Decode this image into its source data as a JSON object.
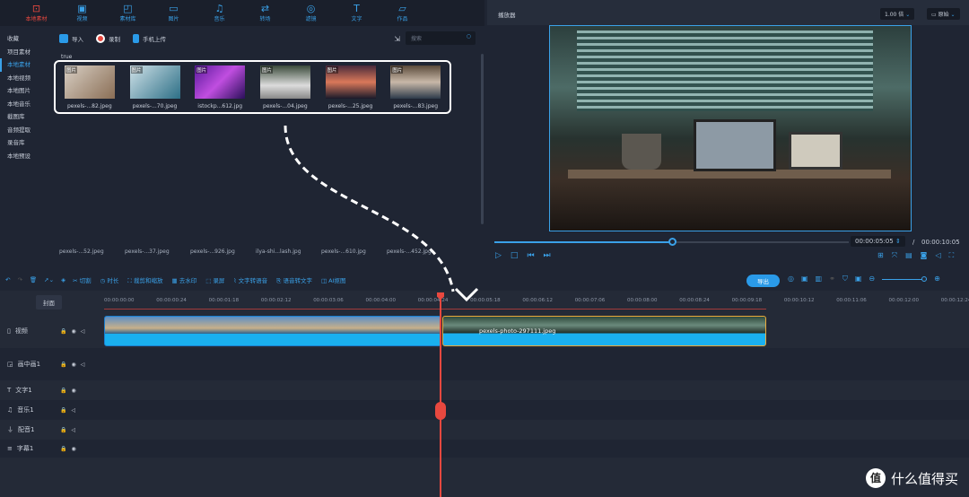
{
  "nav": {
    "tabs": [
      {
        "label": "本地素材",
        "icon": "download-box-icon",
        "active": true
      },
      {
        "label": "视频",
        "icon": "film-icon"
      },
      {
        "label": "素材库",
        "icon": "library-icon"
      },
      {
        "label": "图片",
        "icon": "image-icon"
      },
      {
        "label": "音乐",
        "icon": "music-icon"
      },
      {
        "label": "转场",
        "icon": "swap-icon"
      },
      {
        "label": "滤镜",
        "icon": "filter-icon"
      },
      {
        "label": "文字",
        "icon": "text-icon"
      },
      {
        "label": "作品",
        "icon": "folder-icon"
      }
    ]
  },
  "sidebar": {
    "items": [
      "收藏",
      "项目素材",
      "本地素材",
      "本地视频",
      "本地图片",
      "本地音乐",
      "截图库",
      "音频提取",
      "录音库",
      "本地预设"
    ],
    "active_index": 2
  },
  "toolbar": {
    "import": "导入",
    "record": "录制",
    "phone_upload": "手机上传",
    "search_placeholder": "搜索"
  },
  "group_label": "true",
  "thumbnails": [
    {
      "tag": "图片",
      "name": "pexels-...82.jpeg"
    },
    {
      "tag": "图片",
      "name": "pexels-...70.jpeg"
    },
    {
      "tag": "图片",
      "name": "istockp...612.jpg"
    },
    {
      "tag": "图片",
      "name": "pexels-...04.jpeg"
    },
    {
      "tag": "图片",
      "name": "pexels-...25.jpeg"
    },
    {
      "tag": "图片",
      "name": "pexels-...83.jpeg"
    }
  ],
  "thumbnails_row2": [
    "pexels-...52.jpeg",
    "pexels-...37.jpeg",
    "pexels-...926.jpg",
    "ilya-shi...lash.jpg",
    "pexels-...610.jpg",
    "pexels-...452.jpg"
  ],
  "player": {
    "title": "播放器",
    "speed": "1.00 倍",
    "ratio": "原始",
    "current_time": "00:00:05:05",
    "separator": "/",
    "total_time": "00:00:10:05",
    "progress_percent": 50
  },
  "timeline": {
    "tools": [
      "切割",
      "时长",
      "裁剪和缩放",
      "去水印",
      "录屏",
      "文字转语音",
      "语音转文字",
      "AI抠图"
    ],
    "export": "导出",
    "cover": "封面",
    "ticks": [
      "00:00:00:00",
      "00:00:00:24",
      "00:00:01:18",
      "00:00:02:12",
      "00:00:03:06",
      "00:00:04:00",
      "00:00:04:24",
      "00:00:05:18",
      "00:00:06:12",
      "00:00:07:06",
      "00:00:08:00",
      "00:00:08:24",
      "00:00:09:18",
      "00:00:10:12",
      "00:00:11:06",
      "00:00:12:00",
      "00:00:12:24"
    ],
    "tracks": [
      {
        "label": "视频",
        "icon": "video-track-icon"
      },
      {
        "label": "画中画1",
        "icon": "pip-icon"
      },
      {
        "label": "文字1",
        "icon": "text-icon"
      },
      {
        "label": "音乐1",
        "icon": "music-icon"
      },
      {
        "label": "配音1",
        "icon": "mic-icon"
      },
      {
        "label": "字幕1",
        "icon": "subtitle-icon"
      }
    ],
    "clip2_name": "pexels-photo-297111.jpeg"
  },
  "watermark": {
    "logo": "值",
    "text": "什么值得买"
  },
  "colors": {
    "accent": "#3aa1e8",
    "active": "#e8483f",
    "clip": "#1ab0ef",
    "selected_clip_border": "#e9a93a"
  }
}
